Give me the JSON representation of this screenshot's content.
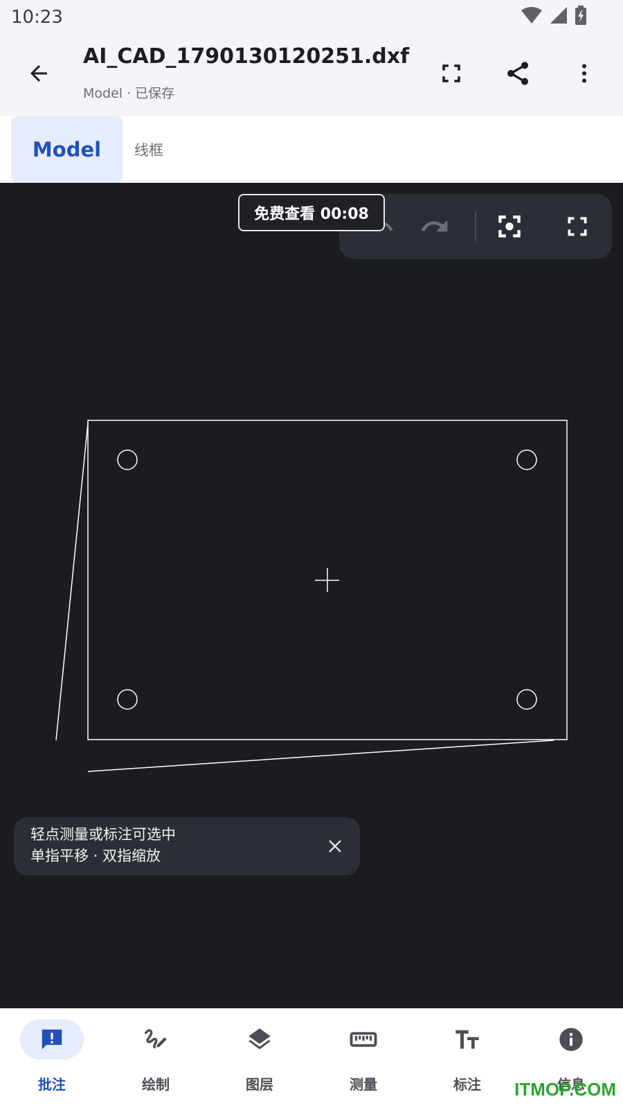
{
  "status_bar": {
    "time": "10:23"
  },
  "app_bar": {
    "file_name": "AI_CAD_1790130120251.dxf",
    "subtitle": "Model · 已保存"
  },
  "tabs": [
    {
      "label": "Model",
      "active": true
    },
    {
      "label": "线框",
      "active": false
    }
  ],
  "canvas": {
    "timer_badge": "免费查看 00:08",
    "hint_line1": "轻点测量或标注可选中",
    "hint_line2": "单指平移 · 双指缩放"
  },
  "bottom_nav": [
    {
      "label": "批注",
      "icon": "comment-alert-icon",
      "active": true
    },
    {
      "label": "绘制",
      "icon": "draw-icon",
      "active": false
    },
    {
      "label": "图层",
      "icon": "layers-icon",
      "active": false
    },
    {
      "label": "测量",
      "icon": "ruler-icon",
      "active": false
    },
    {
      "label": "标注",
      "icon": "text-size-icon",
      "active": false
    },
    {
      "label": "信息",
      "icon": "info-icon",
      "active": false
    }
  ],
  "watermark": "ITMOP.COM",
  "colors": {
    "accent": "#2150b9",
    "accent_bg": "#e6ecfc",
    "canvas": "#1b1c20"
  }
}
